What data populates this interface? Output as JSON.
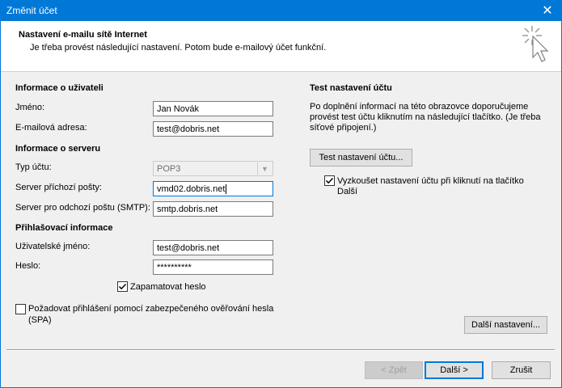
{
  "window": {
    "title": "Změnit účet",
    "close_glyph": "✕"
  },
  "header": {
    "title": "Nastavení e-mailu sítě Internet",
    "subtitle": "Je třeba provést následující nastavení. Potom bude e-mailový účet funkční.",
    "icon": "wand-cursor-icon"
  },
  "user_info": {
    "heading": "Informace o uživateli",
    "name_label": "Jméno:",
    "name_value": "Jan Novák",
    "email_label": "E-mailová adresa:",
    "email_value": "test@dobris.net"
  },
  "server_info": {
    "heading": "Informace o serveru",
    "account_type_label": "Typ účtu:",
    "account_type_value": "POP3",
    "incoming_label": "Server příchozí pošty:",
    "incoming_value": "vmd02.dobris.net",
    "outgoing_label": "Server pro odchozí poštu (SMTP):",
    "outgoing_value": "smtp.dobris.net"
  },
  "login_info": {
    "heading": "Přihlašovací informace",
    "username_label": "Uživatelské jméno:",
    "username_value": "test@dobris.net",
    "password_label": "Heslo:",
    "password_value": "**********",
    "remember_label": "Zapamatovat heslo",
    "remember_checked": true,
    "spa_label_1": "Požadovat přihlášení pomocí zabezpečeného ověřování hesla",
    "spa_label_2": "(SPA)",
    "spa_checked": false
  },
  "test_settings": {
    "heading": "Test nastavení účtu",
    "desc_1": "Po doplnění informací na této obrazovce doporučujeme",
    "desc_2": "provést test účtu kliknutím na následující tlačítko. (Je třeba",
    "desc_3": "síťové připojení.)",
    "test_button": "Test nastavení účtu...",
    "auto_test_label_1": "Vyzkoušet nastavení účtu při kliknutí na tlačítko",
    "auto_test_label_2": "Další",
    "auto_test_checked": true
  },
  "buttons": {
    "more_settings": "Další nastavení...",
    "back": "< Zpět",
    "next": "Další >",
    "cancel": "Zrušit"
  }
}
